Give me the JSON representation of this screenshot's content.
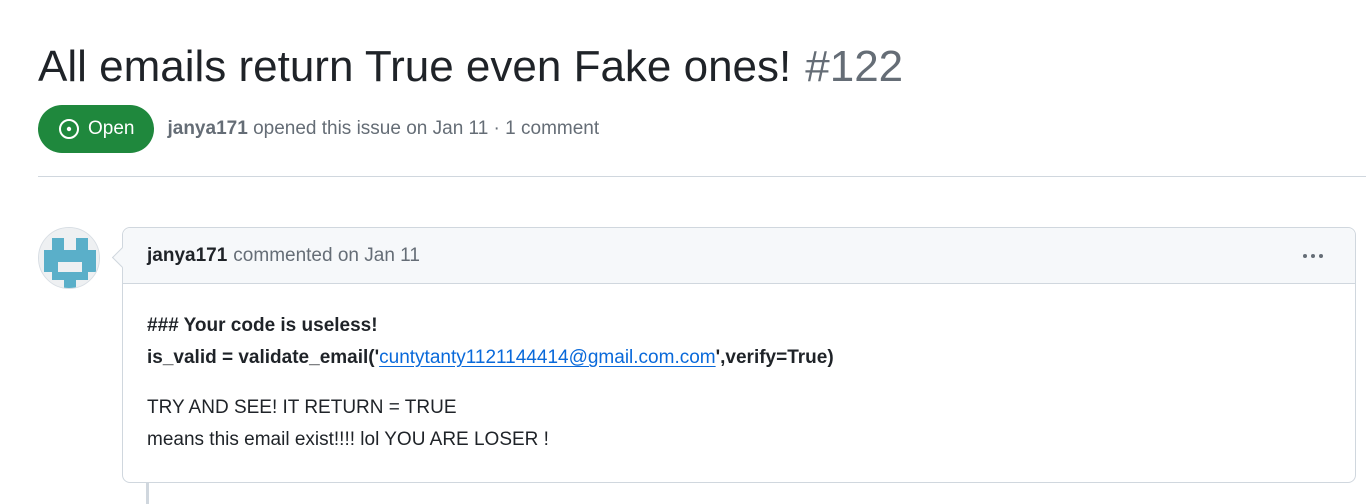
{
  "issue": {
    "title": "All emails return True even Fake ones!",
    "number": "#122",
    "state": "Open",
    "author": "janya171",
    "opened_text": "opened this issue on Jan 11 · 1 comment"
  },
  "comment": {
    "author": "janya171",
    "action_text": "commented on Jan 11",
    "heading": "### Your code is useless!",
    "code_prefix": "is_valid = validate_email('",
    "code_link": "cuntytanty1121144414@gmail.com.com",
    "code_suffix": "',verify=True)",
    "line3": "TRY AND SEE! IT RETURN = TRUE",
    "line4": "means this email exist!!!! lol YOU ARE LOSER !"
  },
  "colors": {
    "open_badge": "#1f883d",
    "link": "#0969da",
    "avatar_blue": "#5aafc9"
  },
  "icons": [
    "issue-open-icon",
    "kebab-menu-icon",
    "identicon-avatar"
  ]
}
